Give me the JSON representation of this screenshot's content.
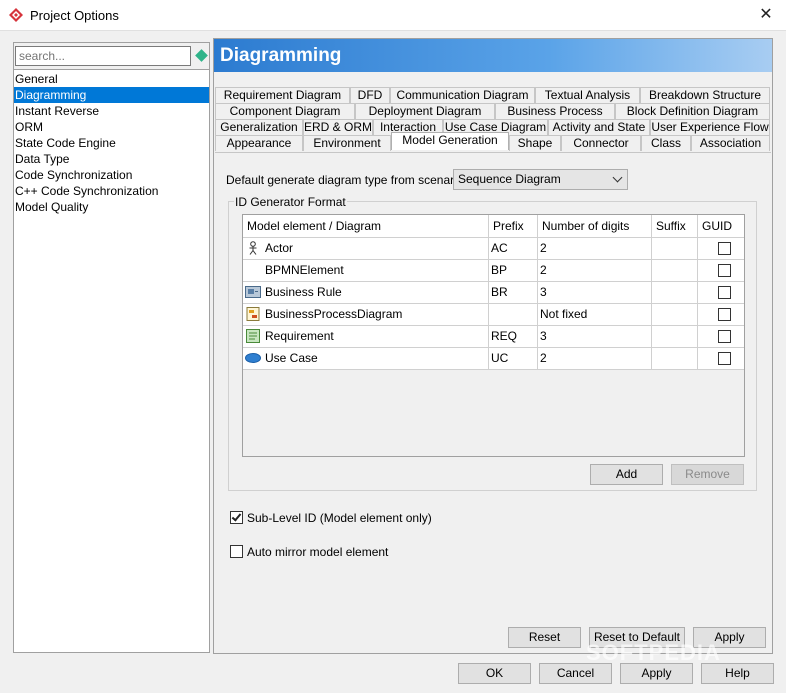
{
  "window": {
    "title": "Project Options"
  },
  "search": {
    "placeholder": "search..."
  },
  "nav": {
    "items": [
      "General",
      "Diagramming",
      "Instant Reverse",
      "ORM",
      "State Code Engine",
      "Data Type",
      "Code Synchronization",
      "C++ Code Synchronization",
      "Model Quality"
    ],
    "selected": "Diagramming"
  },
  "panel": {
    "title": "Diagramming"
  },
  "tabs": {
    "row1": [
      "Requirement Diagram",
      "DFD",
      "Communication Diagram",
      "Textual Analysis",
      "Breakdown Structure"
    ],
    "row2": [
      "Component Diagram",
      "Deployment Diagram",
      "Business Process",
      "Block Definition Diagram"
    ],
    "row3": [
      "Generalization",
      "ERD & ORM",
      "Interaction",
      "Use Case Diagram",
      "Activity and State",
      "User Experience Flow"
    ],
    "row4": [
      "Appearance",
      "Environment",
      "Model Generation",
      "Shape",
      "Connector",
      "Class",
      "Association"
    ],
    "active": "Model Generation"
  },
  "scenario": {
    "label": "Default generate diagram type from scenario :",
    "value": "Sequence Diagram"
  },
  "id_format": {
    "legend": "ID Generator Format",
    "columns": [
      "Model element / Diagram",
      "Prefix",
      "Number of digits",
      "Suffix",
      "GUID"
    ],
    "rows": [
      {
        "element": "Actor",
        "icon": "actor-icon",
        "prefix": "AC",
        "digits": "2",
        "suffix": "",
        "guid": false
      },
      {
        "element": "BPMNElement",
        "icon": "",
        "prefix": "BP",
        "digits": "2",
        "suffix": "",
        "guid": false
      },
      {
        "element": "Business Rule",
        "icon": "business-rule-icon",
        "prefix": "BR",
        "digits": "3",
        "suffix": "",
        "guid": false
      },
      {
        "element": "BusinessProcessDiagram",
        "icon": "business-process-diagram-icon",
        "prefix": "",
        "digits": "Not fixed",
        "suffix": "",
        "guid": false
      },
      {
        "element": "Requirement",
        "icon": "requirement-icon",
        "prefix": "REQ",
        "digits": "3",
        "suffix": "",
        "guid": false
      },
      {
        "element": "Use Case",
        "icon": "use-case-icon",
        "prefix": "UC",
        "digits": "2",
        "suffix": "",
        "guid": false
      }
    ],
    "add_label": "Add",
    "remove_label": "Remove"
  },
  "options": {
    "sub_level_label": "Sub-Level ID (Model element only)",
    "sub_level_checked": true,
    "auto_mirror_label": "Auto mirror model element",
    "auto_mirror_checked": false
  },
  "panel_buttons": {
    "reset": "Reset",
    "reset_default": "Reset to Default",
    "apply": "Apply"
  },
  "dialog_buttons": {
    "ok": "OK",
    "cancel": "Cancel",
    "apply": "Apply",
    "help": "Help"
  },
  "watermark": "SOFTPEDIA",
  "colors": {
    "selection": "#0078d7",
    "banner": "#2c7bd0",
    "search_icon": "#2fb48a"
  }
}
